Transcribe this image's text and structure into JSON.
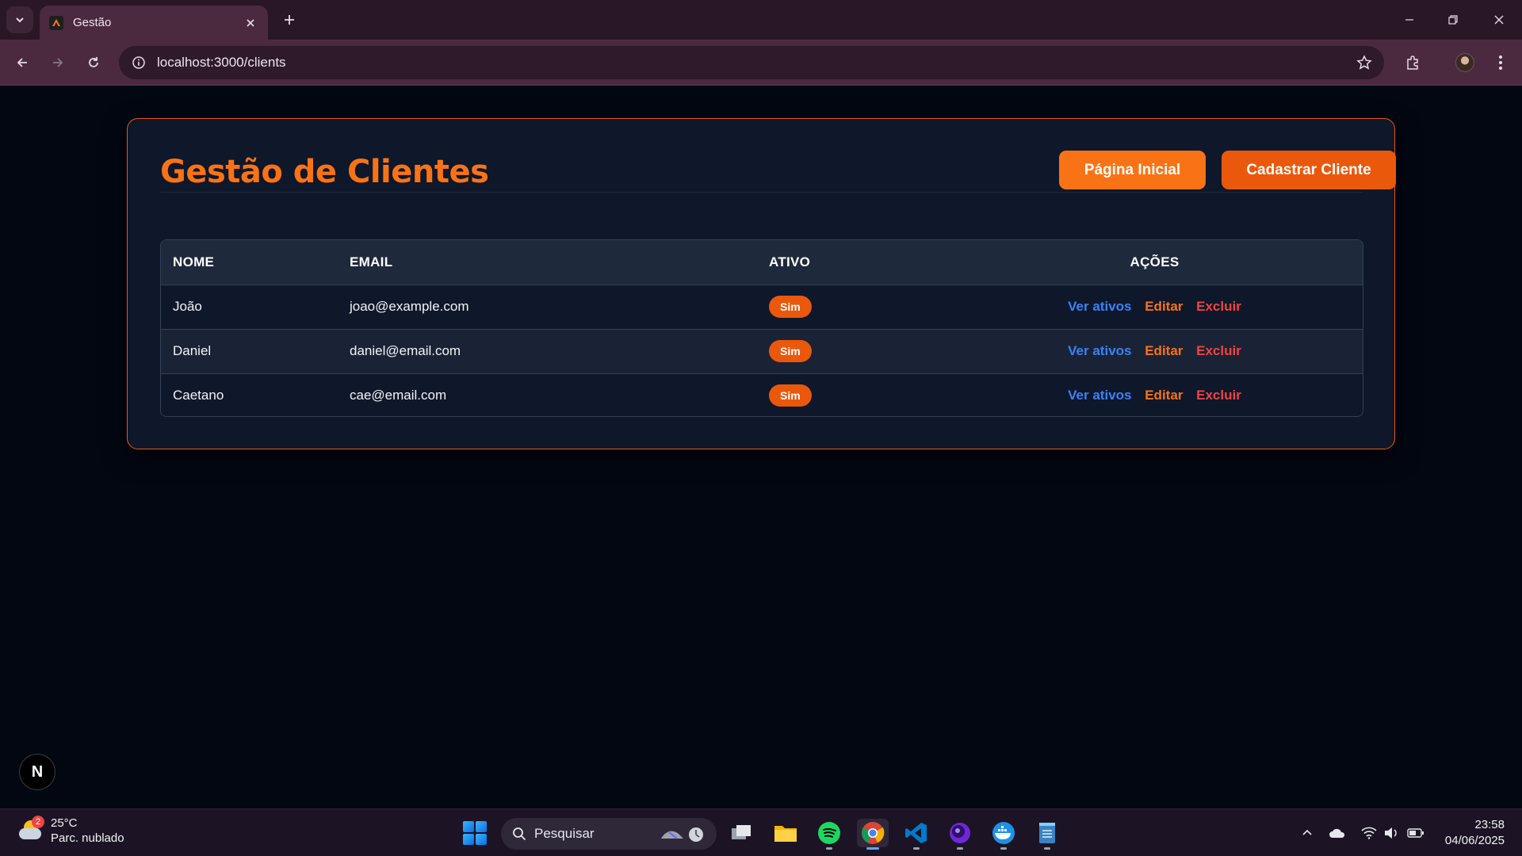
{
  "browser": {
    "tab_title": "Gestão",
    "url": "localhost:3000/clients",
    "icons": [
      "tab-list-icon",
      "close-icon",
      "plus-icon",
      "minimize-icon",
      "restore-icon",
      "back-icon",
      "forward-icon",
      "reload-icon",
      "info-icon",
      "star-icon",
      "extensions-icon",
      "more-icon"
    ]
  },
  "page": {
    "title": "Gestão de Clientes",
    "home_button": "Página Inicial",
    "add_button": "Cadastrar Cliente",
    "colors": {
      "accent": "#f97316",
      "accent_dark": "#ea580c",
      "view": "#3b82f6",
      "delete": "#ef4444"
    }
  },
  "table": {
    "columns": [
      "NOME",
      "EMAIL",
      "ATIVO",
      "AÇÕES"
    ],
    "rows": [
      {
        "name": "João",
        "email": "joao@example.com",
        "active": "Sim"
      },
      {
        "name": "Daniel",
        "email": "daniel@email.com",
        "active": "Sim"
      },
      {
        "name": "Caetano",
        "email": "cae@email.com",
        "active": "Sim"
      }
    ],
    "actions": {
      "view": "Ver ativos",
      "edit": "Editar",
      "delete": "Excluir"
    }
  },
  "dev_badge": "N",
  "taskbar": {
    "weather_temp": "25°C",
    "weather_desc": "Parc. nublado",
    "weather_badge": "2",
    "search_label": "Pesquisar",
    "time": "23:58",
    "date": "04/06/2025"
  }
}
